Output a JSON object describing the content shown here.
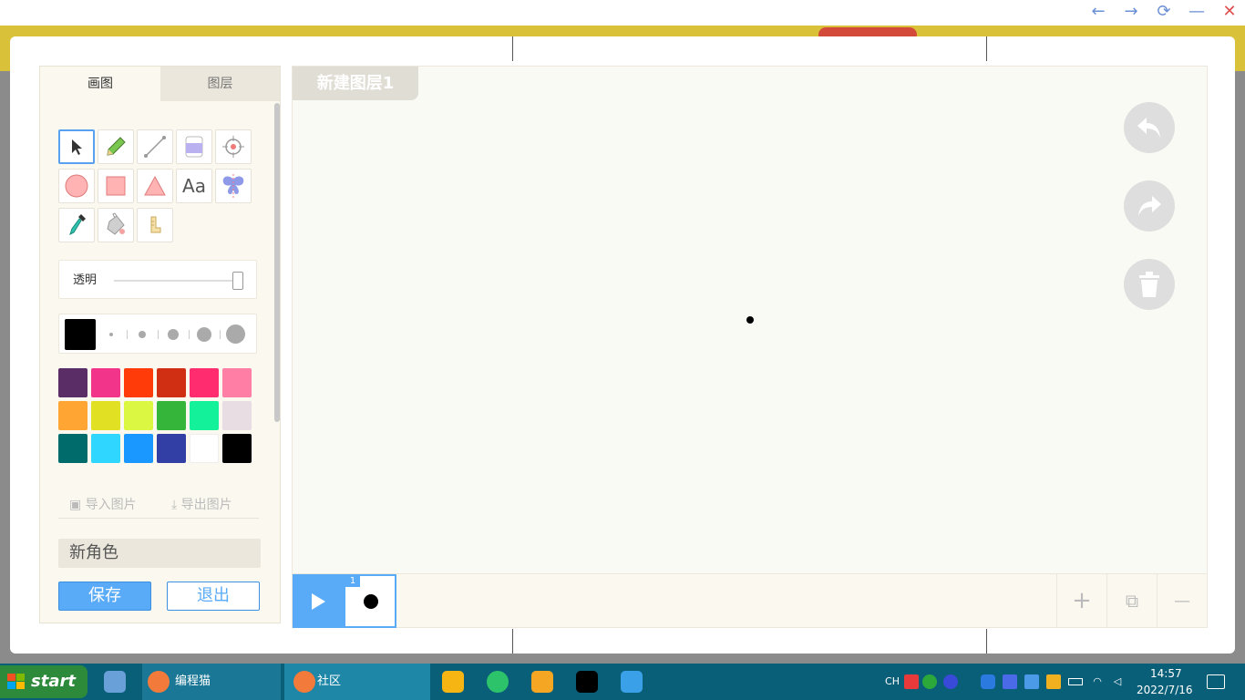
{
  "window_controls": {
    "back": "←",
    "forward": "→",
    "refresh": "⟳",
    "minimize": "—",
    "close": "✕"
  },
  "editor": {
    "tabs": [
      {
        "label": "画图",
        "active": true
      },
      {
        "label": "图层",
        "active": false
      }
    ],
    "tools": [
      {
        "name": "select-tool",
        "icon": "arrow-icon",
        "active": true
      },
      {
        "name": "pencil-tool",
        "icon": "pencil-icon"
      },
      {
        "name": "line-tool",
        "icon": "line-icon"
      },
      {
        "name": "eraser-tool",
        "icon": "eraser-icon"
      },
      {
        "name": "center-tool",
        "icon": "crosshair-icon"
      },
      {
        "name": "circle-tool",
        "icon": "circle-icon"
      },
      {
        "name": "rectangle-tool",
        "icon": "rectangle-icon"
      },
      {
        "name": "triangle-tool",
        "icon": "triangle-icon"
      },
      {
        "name": "text-tool",
        "label": "Aa"
      },
      {
        "name": "mirror-tool",
        "icon": "butterfly-icon"
      },
      {
        "name": "eyedropper-tool",
        "icon": "eyedropper-icon"
      },
      {
        "name": "fill-tool",
        "icon": "paint-bucket-icon"
      },
      {
        "name": "ruler-tool",
        "icon": "ruler-icon"
      }
    ],
    "opacity": {
      "label": "透明",
      "value": 1.0
    },
    "brush": {
      "current_color": "#000000",
      "sizes": 5,
      "selected_size_index": 0
    },
    "palette": [
      "#5b2d66",
      "#f2358a",
      "#ff3b0a",
      "#d12f14",
      "#ff2d6f",
      "#ff7ea6",
      "#ffa533",
      "#e2e022",
      "#dcf742",
      "#36b53b",
      "#13f29a",
      "#e8dde2",
      "#006b6b",
      "#2fd6ff",
      "#1a98ff",
      "#3240a6",
      "#ffffff",
      "#000000"
    ],
    "import_label": "导入图片",
    "export_label": "导出图片",
    "name_value": "新角色",
    "save_label": "保存",
    "exit_label": "退出",
    "layer_name": "新建图层1",
    "frames": [
      {
        "number": "1"
      }
    ],
    "timeline_add": "+",
    "timeline_copy": "⧉",
    "timeline_remove": "—"
  },
  "taskbar": {
    "start_label": "start",
    "tasks": [
      {
        "label": "编程猫"
      },
      {
        "label": "社区"
      }
    ],
    "tray_ime": "CH",
    "clock_time": "14:57",
    "clock_date": "2022/7/16"
  }
}
